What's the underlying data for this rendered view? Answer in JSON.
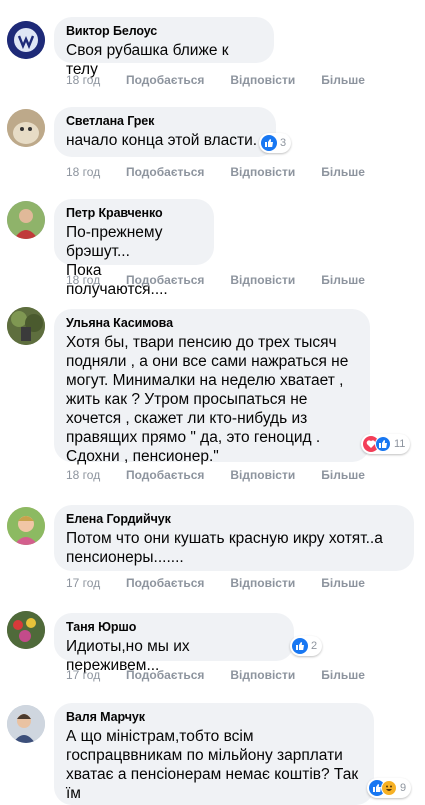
{
  "actions": {
    "like": "Подобається",
    "reply": "Відповісти",
    "more": "Більше"
  },
  "comments": [
    {
      "author": "Виктор Белоус",
      "text": "Своя рубашка ближе к телу",
      "time": "18 год"
    },
    {
      "author": "Светлана Грек",
      "text": "начало конца этой власти.",
      "time": "18 год",
      "reactions": "3"
    },
    {
      "author": "Петр Кравченко",
      "text": "По-прежнему брэшут...\nПока получаются....",
      "time": "18 год"
    },
    {
      "author": "Ульяна Касимова",
      "text": "Хотя бы, твари пенсию до трех тысяч\nподняли , а они все сами нажраться не\nмогут. Минималки на неделю хватает ,\nжить как ? Утром просыпаться не\nхочется , скажет ли кто-нибудь из\nправящих прямо \" да, это геноцид .\nСдохни , пенсионер.\"",
      "time": "18 год",
      "reactions": "11"
    },
    {
      "author": "Елена Гордийчук",
      "text": "Потом что они кушать красную икру хотят..а\nпенсионеры.......",
      "time": "17 год"
    },
    {
      "author": "Таня Юршо",
      "text": "Идиоты,но мы их переживем...",
      "time": "17 год",
      "reactions": "2"
    },
    {
      "author": "Валя Марчук",
      "text": "А що міністрам,тобто всім\nгоспрацввникам по мільйону зарплати\nхватає а пенсіонерам немає коштів? Так\nїм",
      "reactions": "9"
    }
  ]
}
